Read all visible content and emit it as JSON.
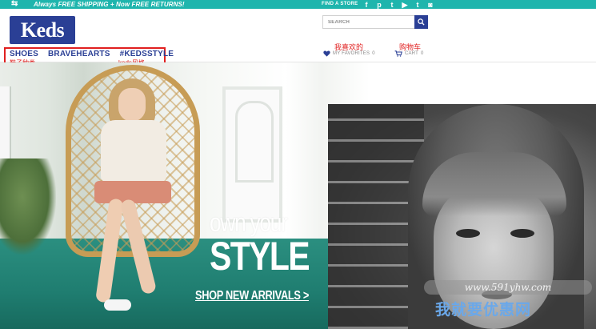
{
  "topbar": {
    "arrows": "⇆",
    "promo": "Always FREE SHIPPING + Now FREE RETURNS!",
    "find_store": "FIND A STORE",
    "social_icons": [
      "pinterest-icon",
      "facebook-icon",
      "twitter-icon",
      "youtube-icon",
      "tumblr-icon",
      "instagram-icon"
    ],
    "social_glyphs": [
      "f",
      "p",
      "t",
      "▶",
      "t",
      "◙"
    ]
  },
  "header": {
    "logo": "Keds",
    "nav": [
      {
        "label": "SHOES"
      },
      {
        "label": "BRAVEHEARTS"
      },
      {
        "label": "#KEDSSTYLE"
      }
    ],
    "nav_annotations": [
      "鞋子种类",
      "keds风格"
    ],
    "search": {
      "placeholder": "SEARCH"
    },
    "favorites": {
      "label": "MY FAVORITES",
      "count": "0",
      "annotation": "我喜欢的"
    },
    "cart": {
      "label": "CART",
      "count": "0",
      "annotation": "购物车"
    }
  },
  "hero": {
    "headline_line1": "own your",
    "headline_line2": "STYLE",
    "cta": "SHOP NEW ARRIVALS >"
  },
  "watermark": {
    "url": "www.591yhw.com",
    "text": "我就要优惠网"
  },
  "colors": {
    "teal": "#1fb5ad",
    "brand_blue": "#2a3f95",
    "annotation_red": "#e02020"
  }
}
